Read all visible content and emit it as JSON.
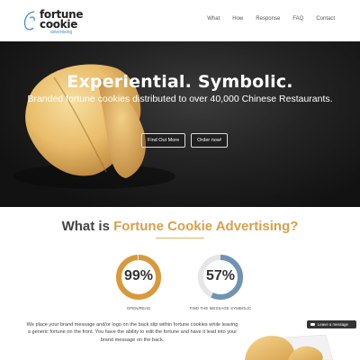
{
  "logo": {
    "line1": "fortune",
    "line2": "cookie",
    "tagline": "advertising"
  },
  "nav": {
    "items": [
      "What",
      "How",
      "Response",
      "FAQ",
      "Contact"
    ]
  },
  "hero": {
    "title": "Experiential. Symbolic.",
    "subtitle": "Branded fortune cookies distributed to over 40,000 Chinese Restaurants.",
    "buttons": [
      "Find Out More",
      "Order now!"
    ]
  },
  "what": {
    "title_prefix": "What is ",
    "title_highlight": "Fortune Cookie Advertising?"
  },
  "stats": [
    {
      "value": "99%",
      "label": "OPEN/READ",
      "fraction": 0.99,
      "color": "#d9993a"
    },
    {
      "value": "57%",
      "label": "FIND THE MESSAGE SYMBOLIC",
      "fraction": 0.57,
      "color": "#6f94b3"
    }
  ],
  "body_text": "We place your brand message and/or logo on the back slip within fortune cookies while leaving a generic fortune on the front. You have the ability to edit the fortune and have it lead into your brand message on the back.",
  "leave_message": "Leave a message"
}
